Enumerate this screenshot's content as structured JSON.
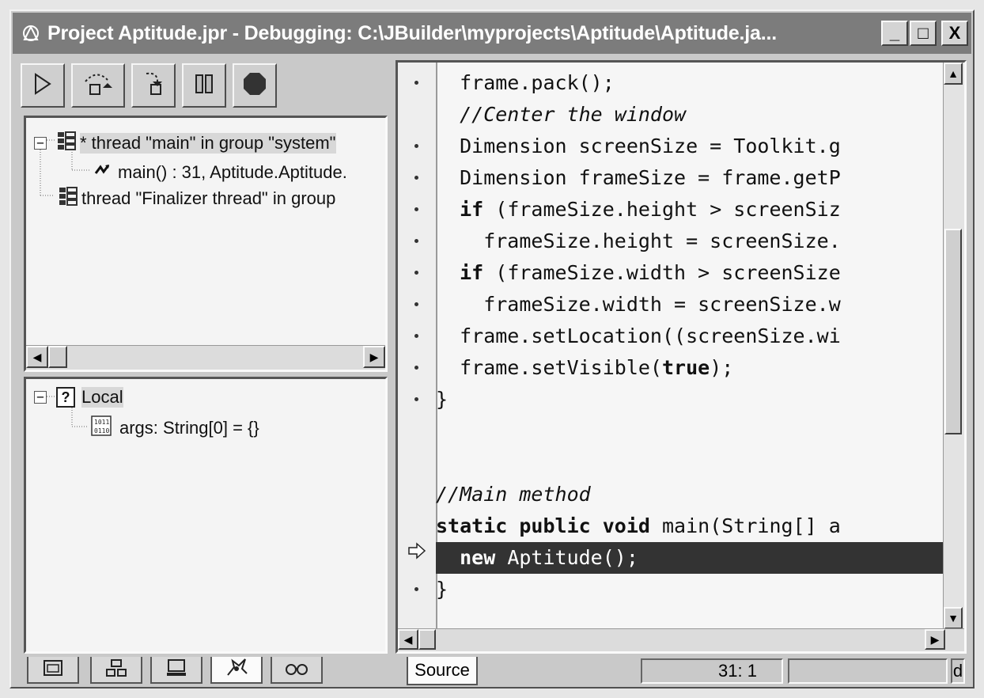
{
  "window": {
    "title": "Project Aptitude.jpr - Debugging: C:\\JBuilder\\myprojects\\Aptitude\\Aptitude.ja...",
    "controls": [
      "_",
      "□",
      "X"
    ]
  },
  "toolbar": {
    "buttons": [
      "run-icon",
      "step-over-icon",
      "step-into-icon",
      "pause-icon",
      "stop-icon"
    ]
  },
  "threads": {
    "items": [
      {
        "label": "* thread \"main\" in group \"system\""
      },
      {
        "label": "main() : 31, Aptitude.Aptitude."
      },
      {
        "label": "thread \"Finalizer thread\" in group"
      }
    ]
  },
  "variables": {
    "root": "Local",
    "items": [
      {
        "label": "args: String[0] = {}"
      }
    ]
  },
  "code": {
    "lines": [
      {
        "text": "  frame.pack();",
        "style": "plain"
      },
      {
        "text": "  //Center the window",
        "style": "comment"
      },
      {
        "text": "  Dimension screenSize = Toolkit.g",
        "style": "plain"
      },
      {
        "text": "  Dimension frameSize = frame.getP",
        "style": "plain"
      },
      {
        "kw": "if",
        "pre": "  ",
        "post": " (frameSize.height > screenSiz",
        "style": "kw"
      },
      {
        "text": "    frameSize.height = screenSize.",
        "style": "plain"
      },
      {
        "kw": "if",
        "pre": "  ",
        "post": " (frameSize.width > screenSize",
        "style": "kw"
      },
      {
        "text": "    frameSize.width = screenSize.w",
        "style": "plain"
      },
      {
        "text": "  frame.setLocation((screenSize.wi",
        "style": "plain"
      },
      {
        "pre": "  frame.setVisible(",
        "kw": "true",
        "post": ");",
        "style": "kw"
      },
      {
        "text": "}",
        "style": "plain"
      },
      {
        "text": "",
        "style": "plain"
      },
      {
        "text": "//Main method",
        "style": "comment"
      },
      {
        "kw": "static public void",
        "pre": "",
        "post": " main(String[] a",
        "style": "kw"
      },
      {
        "kw": "new",
        "pre": "  ",
        "post": " Aptitude();",
        "style": "exec"
      },
      {
        "text": "}",
        "style": "plain"
      }
    ]
  },
  "bottom_tabs": [
    "files-icon",
    "structure-icon",
    "console-icon",
    "threads-icon",
    "watches-icon"
  ],
  "status": {
    "source_tab": "Source",
    "position": "31: 1",
    "mode": "",
    "extra": "d"
  }
}
